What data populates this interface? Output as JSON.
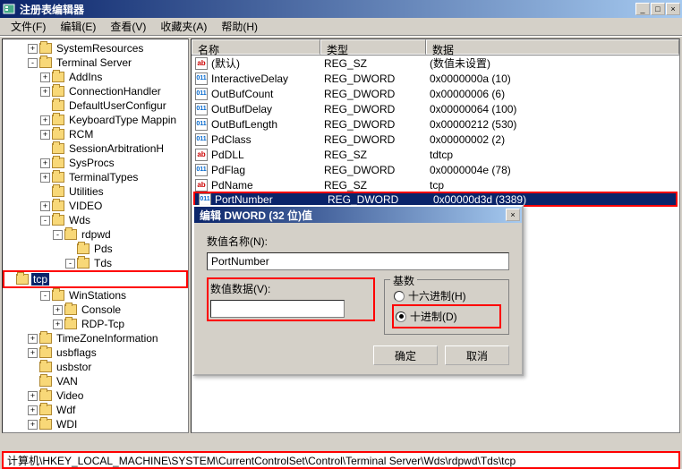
{
  "window": {
    "title": "注册表编辑器",
    "min": "_",
    "max": "□",
    "close": "×"
  },
  "menu": {
    "file": "文件(F)",
    "edit": "编辑(E)",
    "view": "查看(V)",
    "favorites": "收藏夹(A)",
    "help": "帮助(H)"
  },
  "tree": [
    {
      "indent": 2,
      "toggle": "+",
      "label": "SystemResources"
    },
    {
      "indent": 2,
      "toggle": "-",
      "label": "Terminal Server"
    },
    {
      "indent": 3,
      "toggle": "+",
      "label": "AddIns"
    },
    {
      "indent": 3,
      "toggle": "+",
      "label": "ConnectionHandler"
    },
    {
      "indent": 3,
      "toggle": "",
      "label": "DefaultUserConfigur"
    },
    {
      "indent": 3,
      "toggle": "+",
      "label": "KeyboardType Mappin"
    },
    {
      "indent": 3,
      "toggle": "+",
      "label": "RCM"
    },
    {
      "indent": 3,
      "toggle": "",
      "label": "SessionArbitrationH"
    },
    {
      "indent": 3,
      "toggle": "+",
      "label": "SysProcs"
    },
    {
      "indent": 3,
      "toggle": "+",
      "label": "TerminalTypes"
    },
    {
      "indent": 3,
      "toggle": "",
      "label": "Utilities"
    },
    {
      "indent": 3,
      "toggle": "+",
      "label": "VIDEO"
    },
    {
      "indent": 3,
      "toggle": "-",
      "label": "Wds"
    },
    {
      "indent": 4,
      "toggle": "-",
      "label": "rdpwd"
    },
    {
      "indent": 5,
      "toggle": "",
      "label": "Pds"
    },
    {
      "indent": 5,
      "toggle": "-",
      "label": "Tds"
    },
    {
      "indent": 6,
      "toggle": "",
      "label": "tcp",
      "selected": true,
      "redbox": true
    },
    {
      "indent": 3,
      "toggle": "-",
      "label": "WinStations"
    },
    {
      "indent": 4,
      "toggle": "+",
      "label": "Console"
    },
    {
      "indent": 4,
      "toggle": "+",
      "label": "RDP-Tcp"
    },
    {
      "indent": 2,
      "toggle": "+",
      "label": "TimeZoneInformation"
    },
    {
      "indent": 2,
      "toggle": "+",
      "label": "usbflags"
    },
    {
      "indent": 2,
      "toggle": "",
      "label": "usbstor"
    },
    {
      "indent": 2,
      "toggle": "",
      "label": "VAN"
    },
    {
      "indent": 2,
      "toggle": "+",
      "label": "Video"
    },
    {
      "indent": 2,
      "toggle": "+",
      "label": "Wdf"
    },
    {
      "indent": 2,
      "toggle": "+",
      "label": "WDI"
    }
  ],
  "list": {
    "headers": {
      "name": "名称",
      "type": "类型",
      "data": "数据"
    },
    "rows": [
      {
        "icon": "ab",
        "name": "(默认)",
        "type": "REG_SZ",
        "data": "(数值未设置)"
      },
      {
        "icon": "bin",
        "name": "InteractiveDelay",
        "type": "REG_DWORD",
        "data": "0x0000000a (10)"
      },
      {
        "icon": "bin",
        "name": "OutBufCount",
        "type": "REG_DWORD",
        "data": "0x00000006 (6)"
      },
      {
        "icon": "bin",
        "name": "OutBufDelay",
        "type": "REG_DWORD",
        "data": "0x00000064 (100)"
      },
      {
        "icon": "bin",
        "name": "OutBufLength",
        "type": "REG_DWORD",
        "data": "0x00000212 (530)"
      },
      {
        "icon": "bin",
        "name": "PdClass",
        "type": "REG_DWORD",
        "data": "0x00000002 (2)"
      },
      {
        "icon": "ab",
        "name": "PdDLL",
        "type": "REG_SZ",
        "data": "tdtcp"
      },
      {
        "icon": "bin",
        "name": "PdFlag",
        "type": "REG_DWORD",
        "data": "0x0000004e (78)"
      },
      {
        "icon": "ab",
        "name": "PdName",
        "type": "REG_SZ",
        "data": "tcp"
      },
      {
        "icon": "bin",
        "name": "PortNumber",
        "type": "REG_DWORD",
        "data": "0x00000d3d (3389)",
        "selected": true
      }
    ]
  },
  "dialog": {
    "title": "编辑 DWORD (32 位)值",
    "close": "×",
    "name_label": "数值名称(N):",
    "name_value": "PortNumber",
    "data_label": "数值数据(V):",
    "data_value": "",
    "base_label": "基数",
    "hex_label": "十六进制(H)",
    "dec_label": "十进制(D)",
    "ok": "确定",
    "cancel": "取消"
  },
  "statusbar": {
    "path": "计算机\\HKEY_LOCAL_MACHINE\\SYSTEM\\CurrentControlSet\\Control\\Terminal Server\\Wds\\rdpwd\\Tds\\tcp"
  }
}
